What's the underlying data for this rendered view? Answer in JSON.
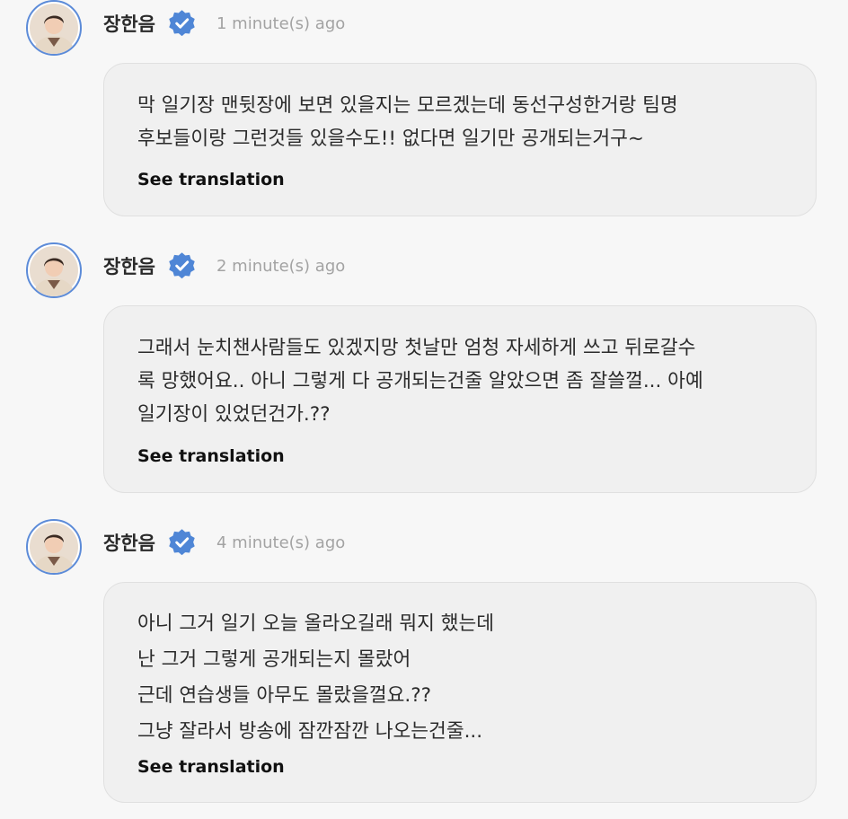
{
  "comments": [
    {
      "author": "장한음",
      "time": "1 minute(s) ago",
      "text": "막 일기장 맨뒷장에 보면 있을지는 모르겠는데 동선구성한거랑 팀명\n후보들이랑 그런것들 있을수도!! 없다면 일기만 공개되는거구~",
      "translate_label": "See translation"
    },
    {
      "author": "장한음",
      "time": "2 minute(s) ago",
      "text": "그래서 눈치챈사람들도 있겠지망 첫날만 엄청 자세하게 쓰고 뒤로갈수\n록 망했어요.. 아니 그렇게 다 공개되는건줄 알았으면 좀 잘쓸껄... 아예\n일기장이 있었던건가.??",
      "translate_label": "See translation"
    },
    {
      "author": "장한음",
      "time": "4 minute(s) ago",
      "text": "아니 그거 일기 오늘 올라오길래 뭐지 했는데\n난 그거 그렇게 공개되는지 몰랐어\n근데 연습생들 아무도 몰랐을껄요.??\n그냥 잘라서 방송에 잠깐잠깐 나오는건줄...",
      "translate_label": "See translation"
    }
  ],
  "icons": {
    "verified": "verified-badge-icon",
    "avatar": "profile-photo"
  },
  "colors": {
    "background": "#f7f7f7",
    "bubble": "#f0f0f0",
    "verified_blue": "#4f86d6",
    "avatar_ring": "#5c8bd8",
    "timestamp": "#a3a3a3"
  }
}
